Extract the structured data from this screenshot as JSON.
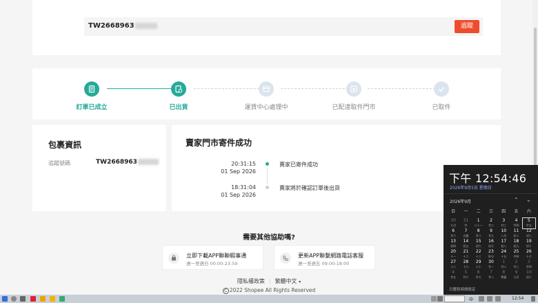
{
  "search": {
    "tracking_prefix": "TW2668963",
    "button_label": "追蹤"
  },
  "steps": [
    {
      "label": "訂單已成立",
      "state": "done"
    },
    {
      "label": "已出貨",
      "state": "done"
    },
    {
      "label": "運貨中心處理中",
      "state": "todo"
    },
    {
      "label": "已配達取件門市",
      "state": "todo"
    },
    {
      "label": "已取件",
      "state": "todo"
    }
  ],
  "package": {
    "title": "包裹資訊",
    "tracking_label": "追蹤號碼",
    "tracking_prefix": "TW2668963"
  },
  "status": {
    "title": "賣家門市寄件成功",
    "events": [
      {
        "time": "20:31:15",
        "date": "01 Sep 2026",
        "desc": "賣家已寄件成功"
      },
      {
        "time": "18:31:04",
        "date": "01 Sep 2026",
        "desc": "賣家將於確認訂單後出貨"
      }
    ]
  },
  "help": {
    "title": "需要其他協助嗎?",
    "cards": [
      {
        "main": "立即下載APP聯聯蝦事通",
        "sub": "週一至週日 00:00-23:59"
      },
      {
        "main": "更新APP聯繫網路電話客服",
        "sub": "週一至週五 09:00-18:00"
      }
    ]
  },
  "footer": {
    "privacy": "隱私權政策",
    "language": "繁體中文",
    "copyright": "2022 Shopee All Rights Reserved"
  },
  "clock": {
    "time": "下午 12:54:46",
    "date": "2026年9月5日 星期日",
    "month": "2026年9月",
    "weekdays": [
      "日",
      "一",
      "二",
      "三",
      "四",
      "五",
      "六"
    ],
    "weeks": [
      [
        [
          "30",
          "七月"
        ],
        [
          "31",
          "廿"
        ],
        [
          "1",
          "二十一"
        ],
        [
          "2",
          "廿二"
        ],
        [
          "3",
          "廿三"
        ],
        [
          "4",
          "廿四"
        ],
        [
          "5",
          "廿五"
        ]
      ],
      [
        [
          "6",
          "廿六"
        ],
        [
          "7",
          "白露"
        ],
        [
          "8",
          "廿八"
        ],
        [
          "9",
          "廿九"
        ],
        [
          "10",
          "八月"
        ],
        [
          "11",
          "初二"
        ],
        [
          "12",
          "初三"
        ]
      ],
      [
        [
          "13",
          "初四"
        ],
        [
          "14",
          "初五"
        ],
        [
          "15",
          "初六"
        ],
        [
          "16",
          "初七"
        ],
        [
          "17",
          "初八"
        ],
        [
          "18",
          "初九"
        ],
        [
          "19",
          "初十"
        ]
      ],
      [
        [
          "20",
          "十一"
        ],
        [
          "21",
          "十二"
        ],
        [
          "22",
          "十三"
        ],
        [
          "23",
          "秋分"
        ],
        [
          "24",
          "十五"
        ],
        [
          "25",
          "中秋"
        ],
        [
          "26",
          "十七"
        ]
      ],
      [
        [
          "27",
          "十八"
        ],
        [
          "28",
          "十九"
        ],
        [
          "29",
          "二十"
        ],
        [
          "30",
          "廿一"
        ],
        [
          "1",
          "廿二"
        ],
        [
          "2",
          "廿三"
        ],
        [
          "3",
          "廿四"
        ]
      ],
      [
        [
          "4",
          "廿五"
        ],
        [
          "5",
          "廿六"
        ],
        [
          "6",
          "廿七"
        ],
        [
          "7",
          "廿八"
        ],
        [
          "8",
          "寒露"
        ],
        [
          "9",
          "九月"
        ],
        [
          "10",
          "初二"
        ]
      ]
    ],
    "footer": "日曆和時間設定"
  },
  "taskbar": {
    "clock": "12:54",
    "ime": "中"
  },
  "colors": {
    "brand": "#ee4d2d",
    "success": "#26aa99",
    "panel": "#1f1f1f"
  }
}
